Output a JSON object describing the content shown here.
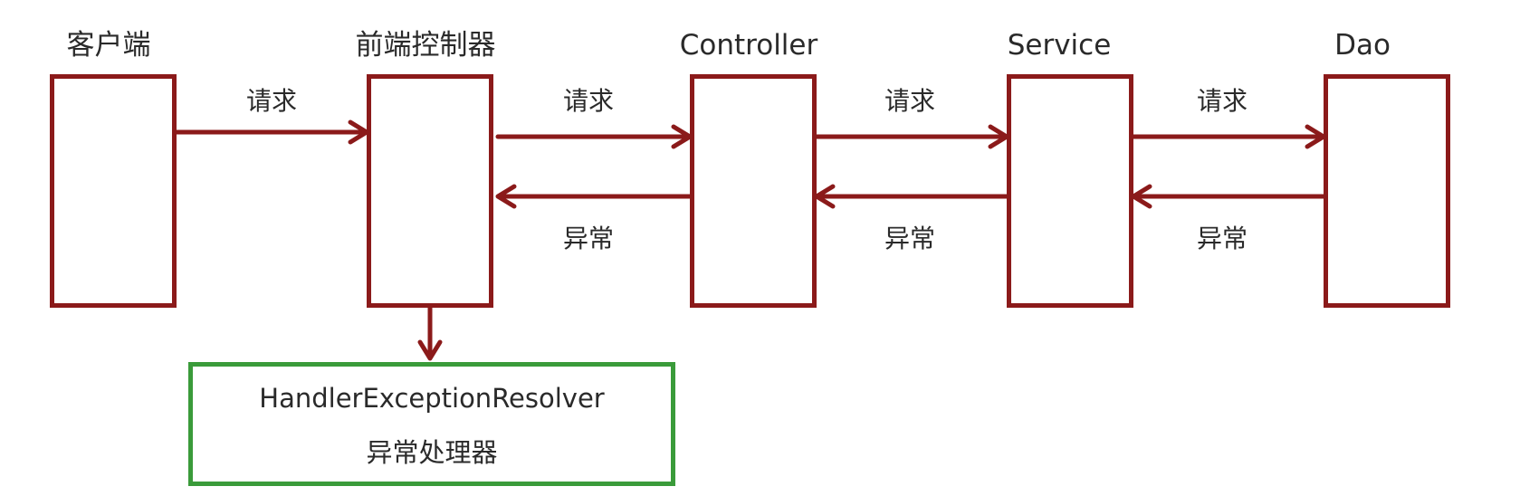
{
  "colors": {
    "layer_border": "#8b1a1a",
    "arrow": "#8b1a1a",
    "handler_border": "#3a9b3a",
    "text": "#2a2a2a"
  },
  "nodes": [
    {
      "id": "client",
      "title": "客户端"
    },
    {
      "id": "front-controller",
      "title": "前端控制器"
    },
    {
      "id": "controller",
      "title": "Controller"
    },
    {
      "id": "service",
      "title": "Service"
    },
    {
      "id": "dao",
      "title": "Dao"
    }
  ],
  "edges": {
    "request_label": "请求",
    "exception_label": "异常",
    "requests": [
      {
        "from": "client",
        "to": "front-controller",
        "label": "请求"
      },
      {
        "from": "front-controller",
        "to": "controller",
        "label": "请求"
      },
      {
        "from": "controller",
        "to": "service",
        "label": "请求"
      },
      {
        "from": "service",
        "to": "dao",
        "label": "请求"
      }
    ],
    "exceptions": [
      {
        "from": "controller",
        "to": "front-controller",
        "label": "异常"
      },
      {
        "from": "service",
        "to": "controller",
        "label": "异常"
      },
      {
        "from": "dao",
        "to": "service",
        "label": "异常"
      }
    ]
  },
  "handler": {
    "name": "HandlerExceptionResolver",
    "subtitle": "异常处理器"
  }
}
